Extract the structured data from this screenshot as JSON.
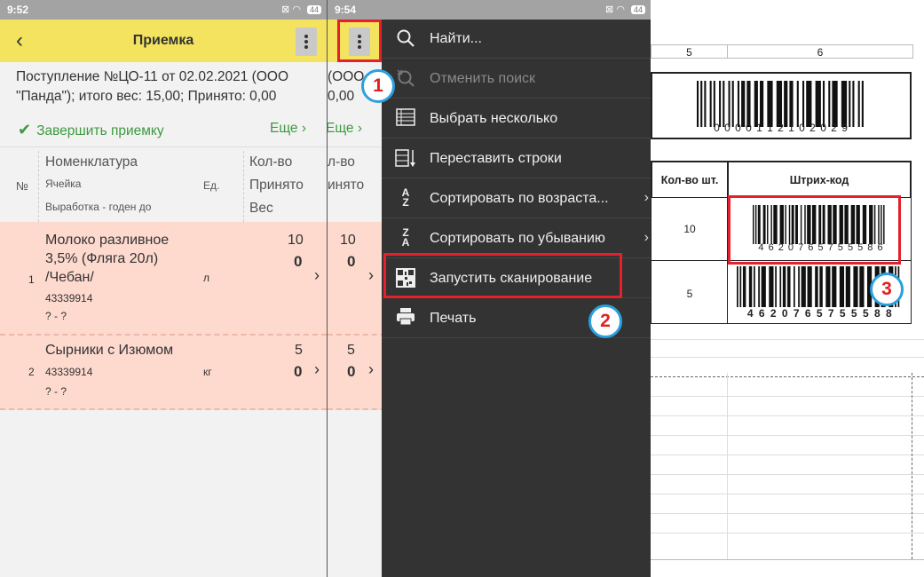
{
  "left_phone": {
    "status_time": "9:52",
    "status_battery": "44",
    "title": "Приемка",
    "header_line1": "Поступление №ЦО-11 от 02.02.2021 (ООО",
    "header_line2": "\"Панда\"); итого вес: 15,00; Принято: 0,00",
    "complete_label": "Завершить приемку",
    "more_label": "Еще",
    "columns": {
      "num": "№",
      "nomenclature": "Номенклатура",
      "cell": "Ячейка",
      "output": "Выработка - годен до",
      "unit": "Ед.",
      "qty": "Кол-во",
      "accepted": "Принято",
      "weight": "Вес"
    },
    "rows": [
      {
        "num": "1",
        "name_line1": "Молоко разливное",
        "name_line2": "3,5% (Фляга 20л)",
        "name_line3": "/Чебан/",
        "cell": "43339914",
        "output": "? - ?",
        "unit": "л",
        "qty": "10",
        "accepted": "0"
      },
      {
        "num": "2",
        "name_line1": "Сырники с Изюмом",
        "cell": "43339914",
        "output": "? - ?",
        "unit": "кг",
        "qty": "5",
        "accepted": "0"
      }
    ]
  },
  "right_phone": {
    "status_time": "9:54",
    "header_line1_partial": "(ООО",
    "header_line2_partial": "0,00",
    "more_label": "Еще",
    "qty_head_partial": "л-во",
    "accepted_head_partial": "инято",
    "rows": [
      {
        "qty": "10",
        "accepted": "0"
      },
      {
        "qty": "5",
        "accepted": "0"
      }
    ]
  },
  "menu": {
    "items": [
      {
        "label": "Найти...",
        "icon": "search-icon",
        "disabled": false
      },
      {
        "label": "Отменить поиск",
        "icon": "cancel-search-icon",
        "disabled": true
      },
      {
        "label": "Выбрать несколько",
        "icon": "list-select-icon",
        "disabled": false
      },
      {
        "label": "Переставить строки",
        "icon": "reorder-rows-icon",
        "disabled": false
      },
      {
        "label": "Сортировать по возраста...",
        "icon": "sort-asc-icon",
        "disabled": false
      },
      {
        "label": "Сортировать по убыванию",
        "icon": "sort-desc-icon",
        "disabled": false
      },
      {
        "label": "Запустить сканирование",
        "icon": "qr-scan-icon",
        "disabled": false
      },
      {
        "label": "Печать",
        "icon": "printer-icon",
        "disabled": false
      }
    ]
  },
  "callouts": [
    "1",
    "2",
    "3"
  ],
  "sheet": {
    "col5": "5",
    "col6": "6",
    "barcode_top_digits": "0 0 0 0 1 1 2 1 0 2 0 2 9",
    "qty_header": "Кол-во шт.",
    "barcode_header": "Штрих-код",
    "rows": [
      {
        "qty": "10",
        "barcode_digits": "4 6 2 0 7 6 5 7 5 5 5 8 6"
      },
      {
        "qty": "5",
        "barcode_digits": "4 6 2 0 7 6 5 7 5 5 5 8 8"
      }
    ]
  },
  "colors": {
    "titlebar": "#f4e35f",
    "row_bg": "#fdd9ce",
    "menu_bg": "#333333",
    "accent_green": "#3e9a40",
    "highlight_red": "#e3202b",
    "callout_blue": "#2aa0dd"
  }
}
